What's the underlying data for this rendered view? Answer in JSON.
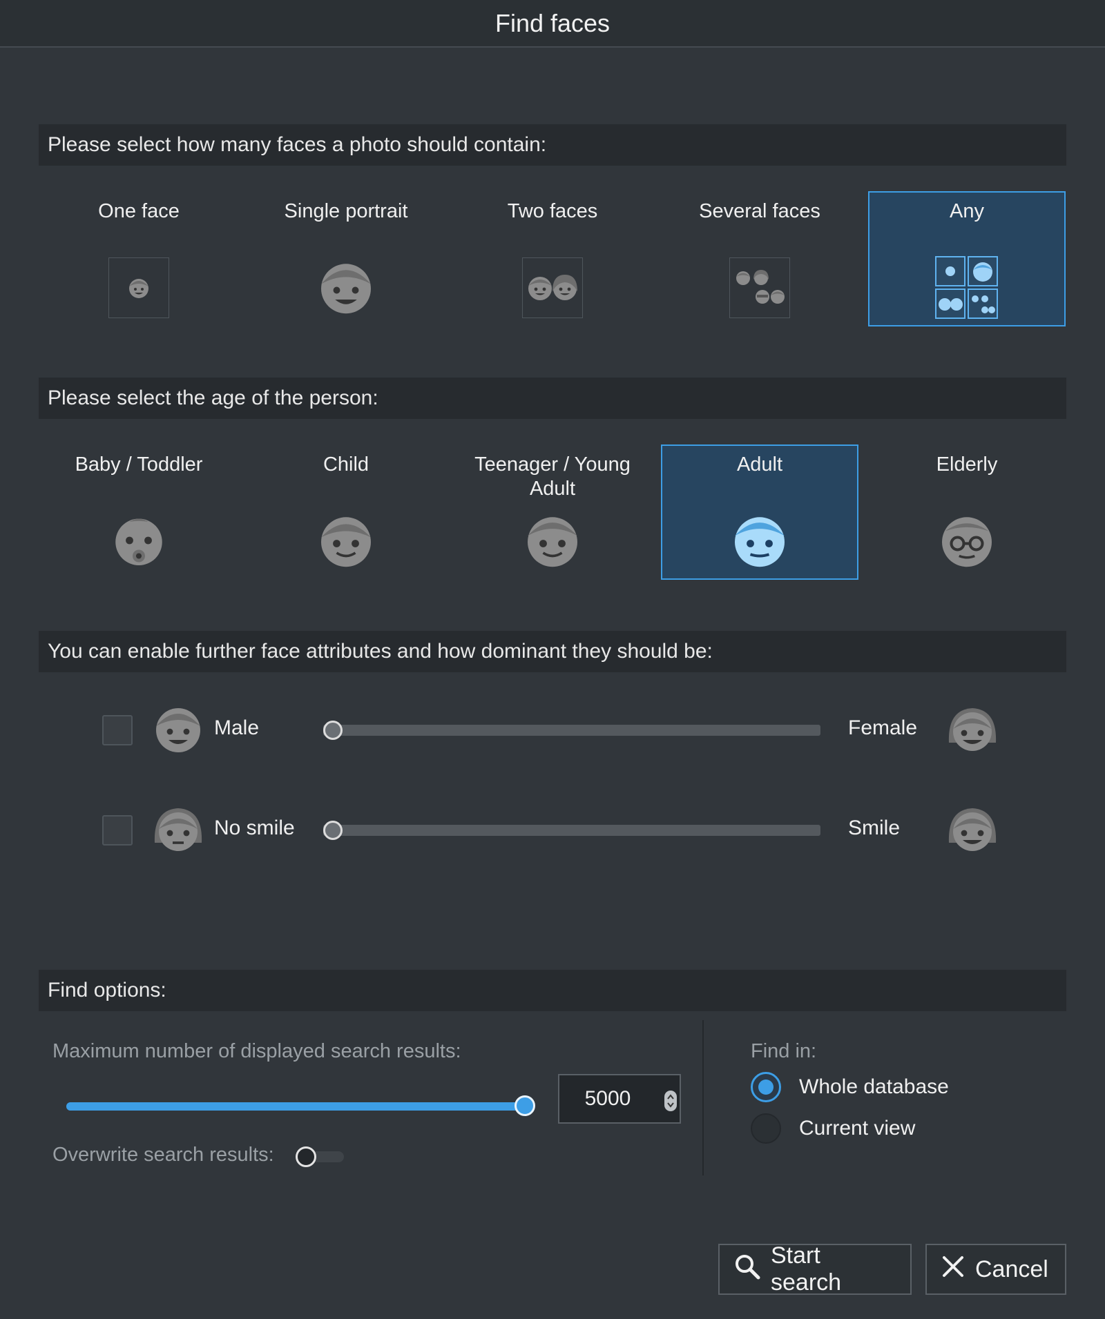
{
  "window": {
    "title": "Find faces"
  },
  "faces_section": {
    "header": "Please select how many faces a photo should contain:",
    "options": [
      {
        "label": "One face",
        "icon": "one-face-icon",
        "selected": false
      },
      {
        "label": "Single portrait",
        "icon": "single-portrait-icon",
        "selected": false
      },
      {
        "label": "Two faces",
        "icon": "two-faces-icon",
        "selected": false
      },
      {
        "label": "Several faces",
        "icon": "several-faces-icon",
        "selected": false
      },
      {
        "label": "Any",
        "icon": "any-faces-icon",
        "selected": true
      }
    ]
  },
  "age_section": {
    "header": "Please select the age of the person:",
    "options": [
      {
        "label": "Baby / Toddler",
        "icon": "baby-face-icon",
        "selected": false
      },
      {
        "label": "Child",
        "icon": "child-face-icon",
        "selected": false
      },
      {
        "label": "Teenager / Young Adult",
        "icon": "teenager-face-icon",
        "selected": false
      },
      {
        "label": "Adult",
        "icon": "adult-face-icon",
        "selected": true
      },
      {
        "label": "Elderly",
        "icon": "elderly-face-icon",
        "selected": false
      }
    ]
  },
  "attributes_section": {
    "header": "You can enable further face attributes and how dominant they should be:",
    "rows": [
      {
        "left_label": "Male",
        "right_label": "Female",
        "enabled": false,
        "value": 0.0
      },
      {
        "left_label": "No smile",
        "right_label": "Smile",
        "enabled": false,
        "value": 0.0
      }
    ]
  },
  "find_options": {
    "header": "Find options:",
    "max_results_label": "Maximum number of displayed search results:",
    "max_results_value": "5000",
    "max_results_fraction": 1.0,
    "overwrite_label": "Overwrite search results:",
    "overwrite_on": false,
    "find_in_label": "Find in:",
    "find_in_options": [
      {
        "label": "Whole database",
        "checked": true
      },
      {
        "label": "Current view",
        "checked": false
      }
    ]
  },
  "buttons": {
    "start_search": "Start search",
    "cancel": "Cancel"
  },
  "colors": {
    "accent": "#3d9ee6",
    "background": "#31363b",
    "header_bg": "#272b2f",
    "selected_bg": "#274560"
  }
}
